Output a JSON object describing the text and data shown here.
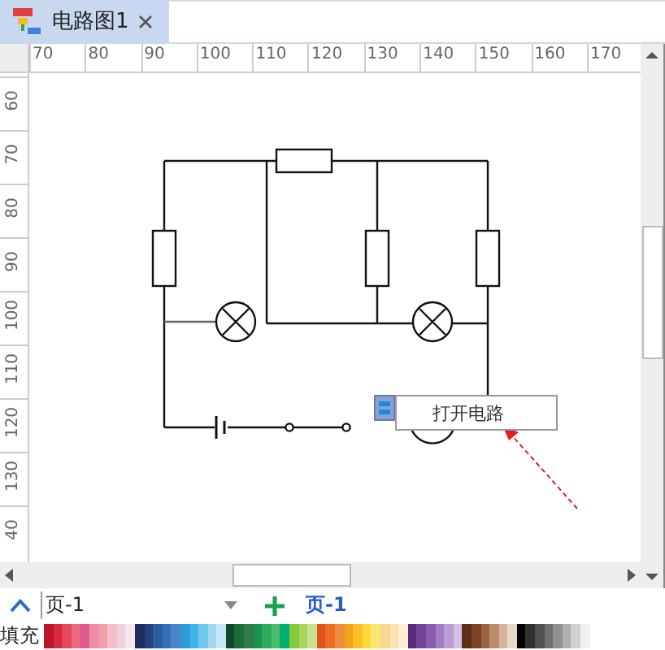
{
  "tabs": [
    {
      "title": "电路图1",
      "selected": true
    }
  ],
  "ruler_h": [
    "70",
    "80",
    "90",
    "100",
    "110",
    "120",
    "130",
    "140",
    "150",
    "160",
    "170"
  ],
  "ruler_v": [
    "60",
    "70",
    "80",
    "90",
    "100",
    "110",
    "120",
    "130",
    "40"
  ],
  "popup": {
    "text": "打开电路"
  },
  "page_bar": {
    "page_select": "页-1",
    "pages": [
      {
        "label": "页-1",
        "selected": true
      }
    ]
  },
  "palette": {
    "label": "填充",
    "swatches": [
      {
        "color": "#c0142c"
      },
      {
        "color": "#d8283c"
      },
      {
        "color": "#e4485c"
      },
      {
        "color": "#ec6c80"
      },
      {
        "color": "#e05a8c"
      },
      {
        "color": "#ec8aa8"
      },
      {
        "color": "#f0a0a8"
      },
      {
        "color": "#f4c0c8"
      },
      {
        "color": "#f0d0e0"
      },
      {
        "color": "#f8e4ec"
      },
      {
        "color": "#1c2c5c"
      },
      {
        "color": "#24407c"
      },
      {
        "color": "#2c5ca0"
      },
      {
        "color": "#3470b8"
      },
      {
        "color": "#4c84c8"
      },
      {
        "color": "#2c9cd8"
      },
      {
        "color": "#40b4e8"
      },
      {
        "color": "#70c8ec"
      },
      {
        "color": "#a0d8f0"
      },
      {
        "color": "#c8e8f8"
      },
      {
        "color": "#0c4c2c"
      },
      {
        "color": "#1c6c3c"
      },
      {
        "color": "#2c7c44"
      },
      {
        "color": "#14944c"
      },
      {
        "color": "#2cac5c"
      },
      {
        "color": "#4cbc6c"
      },
      {
        "color": "#00b070"
      },
      {
        "color": "#84c83c"
      },
      {
        "color": "#a8d45c"
      },
      {
        "color": "#c8e090"
      },
      {
        "color": "#e4501c"
      },
      {
        "color": "#ec6c24"
      },
      {
        "color": "#f08c3c"
      },
      {
        "color": "#f4a41c"
      },
      {
        "color": "#f8c020"
      },
      {
        "color": "#fcd83c"
      },
      {
        "color": "#fce870"
      },
      {
        "color": "#f8d890"
      },
      {
        "color": "#fce4b0"
      },
      {
        "color": "#fcf0d4"
      },
      {
        "color": "#5c2c7c"
      },
      {
        "color": "#74449c"
      },
      {
        "color": "#8c5cb4"
      },
      {
        "color": "#a47cc4"
      },
      {
        "color": "#bc9cd4"
      },
      {
        "color": "#d4c0e4"
      },
      {
        "color": "#5c3014"
      },
      {
        "color": "#7c4424"
      },
      {
        "color": "#9c6440"
      },
      {
        "color": "#bc8c6c"
      },
      {
        "color": "#d4b49c"
      },
      {
        "color": "#e8d8c8"
      },
      {
        "color": "#000000"
      },
      {
        "color": "#303030"
      },
      {
        "color": "#505050"
      },
      {
        "color": "#707070"
      },
      {
        "color": "#909090"
      },
      {
        "color": "#b0b0b0"
      },
      {
        "color": "#d0d0d0"
      },
      {
        "color": "#f0f0f0"
      }
    ]
  }
}
